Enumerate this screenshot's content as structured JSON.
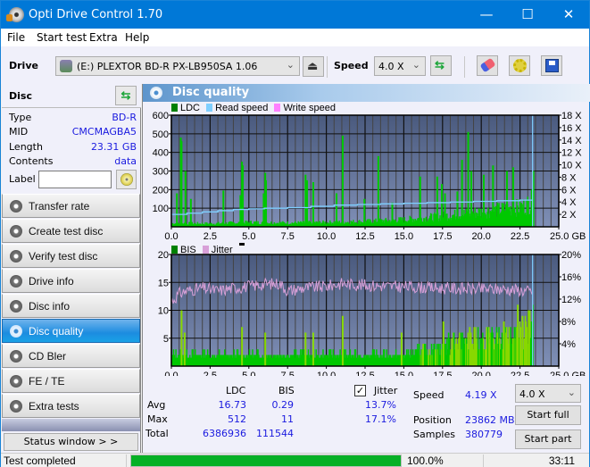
{
  "window": {
    "title": "Opti Drive Control 1.70",
    "controls": {
      "minimize": "—",
      "maximize": "☐",
      "close": "✕"
    }
  },
  "menu": [
    "File",
    "Start test",
    "Extra",
    "Help"
  ],
  "toolbar": {
    "drive_label": "Drive",
    "drive_value": "(E:)  PLEXTOR BD-R  PX-LB950SA 1.06",
    "speed_label": "Speed",
    "speed_value": "4.0 X",
    "icons": [
      "drive-icon",
      "eject-icon",
      "refresh-icon",
      "erase-icon",
      "settings-icon",
      "save-icon"
    ]
  },
  "disc": {
    "heading": "Disc",
    "rows": [
      {
        "key": "Type",
        "value": "BD-R"
      },
      {
        "key": "MID",
        "value": "CMCMAGBA5"
      },
      {
        "key": "Length",
        "value": "23.31 GB"
      },
      {
        "key": "Contents",
        "value": "data"
      }
    ],
    "label_key": "Label",
    "label_value": ""
  },
  "nav": [
    {
      "label": "Transfer rate",
      "active": false
    },
    {
      "label": "Create test disc",
      "active": false
    },
    {
      "label": "Verify test disc",
      "active": false
    },
    {
      "label": "Drive info",
      "active": false
    },
    {
      "label": "Disc info",
      "active": false
    },
    {
      "label": "Disc quality",
      "active": true
    },
    {
      "label": "CD Bler",
      "active": false
    },
    {
      "label": "FE / TE",
      "active": false
    },
    {
      "label": "Extra tests",
      "active": false
    }
  ],
  "status_window_button": "Status window > >",
  "panel": {
    "title": "Disc quality"
  },
  "colors": {
    "ldc": "#00c800",
    "read_speed": "#7fcfff",
    "write_speed": "#ff80ff",
    "bis": "#00c800",
    "bis_high": "#88d800",
    "jitter": "#d8a0d8",
    "plot_bg_top": "#4a5a7e",
    "plot_bg_bottom": "#7f8fb6",
    "accent": "#0078d7",
    "progress": "#06b025"
  },
  "chart_data": [
    {
      "type": "bar",
      "title": "LDC / Read speed",
      "legend": [
        "LDC",
        "Read speed",
        "Write speed"
      ],
      "legend_position": "top-left",
      "xlabel": "GB",
      "x_ticks": [
        "0.0",
        "2.5",
        "5.0",
        "7.5",
        "10.0",
        "12.5",
        "15.0",
        "17.5",
        "20.0",
        "22.5",
        "25.0 GB"
      ],
      "xlim": [
        0,
        25
      ],
      "y_ticks": [
        "100",
        "200",
        "300",
        "400",
        "500",
        "600"
      ],
      "ylim": [
        0,
        600
      ],
      "y2_ticks": [
        "2 X",
        "4 X",
        "6 X",
        "8 X",
        "10 X",
        "12 X",
        "14 X",
        "16 X",
        "18 X"
      ],
      "y2lim": [
        0,
        18
      ],
      "grid": true,
      "ldc_baseline": {
        "x": [
          0,
          2.5,
          5,
          7.5,
          10,
          12.5,
          15,
          17.5,
          20,
          22.5,
          23.31
        ],
        "y": [
          20,
          18,
          25,
          22,
          25,
          30,
          40,
          60,
          85,
          110,
          140
        ]
      },
      "ldc_spikes": {
        "x": [
          0.3,
          0.55,
          0.6,
          0.85,
          1.2,
          3.3,
          4.4,
          4.5,
          4.55,
          5.9,
          6.0,
          6.05,
          8.6,
          8.7,
          9.1,
          10.6,
          11.0,
          12.4,
          13.3,
          14.2,
          16.0,
          17.1,
          17.4,
          17.6,
          18.4,
          18.7,
          19.1,
          19.3,
          20.1,
          20.7,
          21.6,
          22.0,
          23.2,
          23.31
        ],
        "y": [
          180,
          480,
          460,
          300,
          150,
          195,
          170,
          350,
          330,
          180,
          290,
          250,
          280,
          250,
          240,
          180,
          490,
          150,
          380,
          130,
          270,
          270,
          230,
          180,
          190,
          360,
          510,
          300,
          280,
          330,
          300,
          320,
          200,
          300
        ]
      },
      "read_speed": {
        "x": [
          0,
          1.0,
          2.0,
          3.0,
          4.0,
          5.0,
          6.0,
          7.5,
          9.0,
          10.5,
          12.0,
          13.5,
          15.0,
          16.5,
          18.0,
          19.5,
          21.0,
          22.5,
          23.31
        ],
        "y": [
          2.0,
          2.2,
          2.4,
          2.6,
          2.8,
          2.9,
          3.0,
          3.1,
          3.3,
          3.5,
          3.6,
          3.7,
          3.8,
          3.9,
          4.0,
          4.1,
          4.2,
          4.3,
          4.3
        ]
      },
      "end_marker_x": 23.31
    },
    {
      "type": "bar",
      "title": "BIS / Jitter",
      "legend": [
        "BIS",
        "Jitter"
      ],
      "legend_position": "top-left",
      "xlabel": "GB",
      "x_ticks": [
        "0.0",
        "2.5",
        "5.0",
        "7.5",
        "10.0",
        "12.5",
        "15.0",
        "17.5",
        "20.0",
        "22.5",
        "25.0 GB"
      ],
      "xlim": [
        0,
        25
      ],
      "y_ticks": [
        "5",
        "10",
        "15",
        "20"
      ],
      "ylim": [
        0,
        20
      ],
      "y2_ticks": [
        "4%",
        "8%",
        "12%",
        "16%",
        "20%"
      ],
      "y2lim": [
        0,
        20
      ],
      "grid": true,
      "bis_baseline": {
        "x": [
          0,
          2.5,
          5,
          7.5,
          10,
          12.5,
          15,
          17.5,
          20,
          22.5,
          23.31
        ],
        "y": [
          2,
          2,
          2,
          2,
          2,
          2,
          2,
          4,
          5,
          6,
          9
        ]
      },
      "bis_spikes": {
        "x": [
          0.6,
          0.8,
          4.5,
          6.0,
          8.6,
          9.1,
          11.0,
          14.8,
          17.5,
          19.2,
          21.4,
          22.3,
          22.6,
          23.0
        ],
        "y": [
          10,
          6,
          7,
          6,
          6,
          6,
          9,
          6,
          8,
          7,
          8,
          11,
          9,
          10
        ]
      },
      "jitter": {
        "x": [
          0,
          0.5,
          1.0,
          2.0,
          3.0,
          4.0,
          5.0,
          6.0,
          7.0,
          7.5,
          8.5,
          10.0,
          11.0,
          12.5,
          14.0,
          15.5,
          17.0,
          18.5,
          20.0,
          21.5,
          22.5,
          23.31
        ],
        "y": [
          11.5,
          13.0,
          13.5,
          14.0,
          13.5,
          14.0,
          14.3,
          14.7,
          14.8,
          13.5,
          14.0,
          14.3,
          14.8,
          14.5,
          14.3,
          14.2,
          14.0,
          13.9,
          13.8,
          13.8,
          13.6,
          13.3
        ]
      },
      "end_marker_x": 23.31
    }
  ],
  "stats": {
    "col_ldc": "LDC",
    "col_bis": "BIS",
    "jitter_checked": true,
    "jitter_label": "Jitter",
    "rows": [
      {
        "label": "Avg",
        "ldc": "16.73",
        "bis": "0.29",
        "jitter": "13.7%"
      },
      {
        "label": "Max",
        "ldc": "512",
        "bis": "11",
        "jitter": "17.1%"
      },
      {
        "label": "Total",
        "ldc": "6386936",
        "bis": "111544",
        "jitter": ""
      }
    ],
    "speed_label": "Speed",
    "speed_value": "4.19 X",
    "position_label": "Position",
    "position_value": "23862 MB",
    "samples_label": "Samples",
    "samples_value": "380779",
    "speed_select": "4.0 X",
    "start_full": "Start full",
    "start_part": "Start part"
  },
  "statusbar": {
    "text": "Test completed",
    "progress_percent": 100.0,
    "progress_text": "100.0%",
    "time": "33:11"
  }
}
